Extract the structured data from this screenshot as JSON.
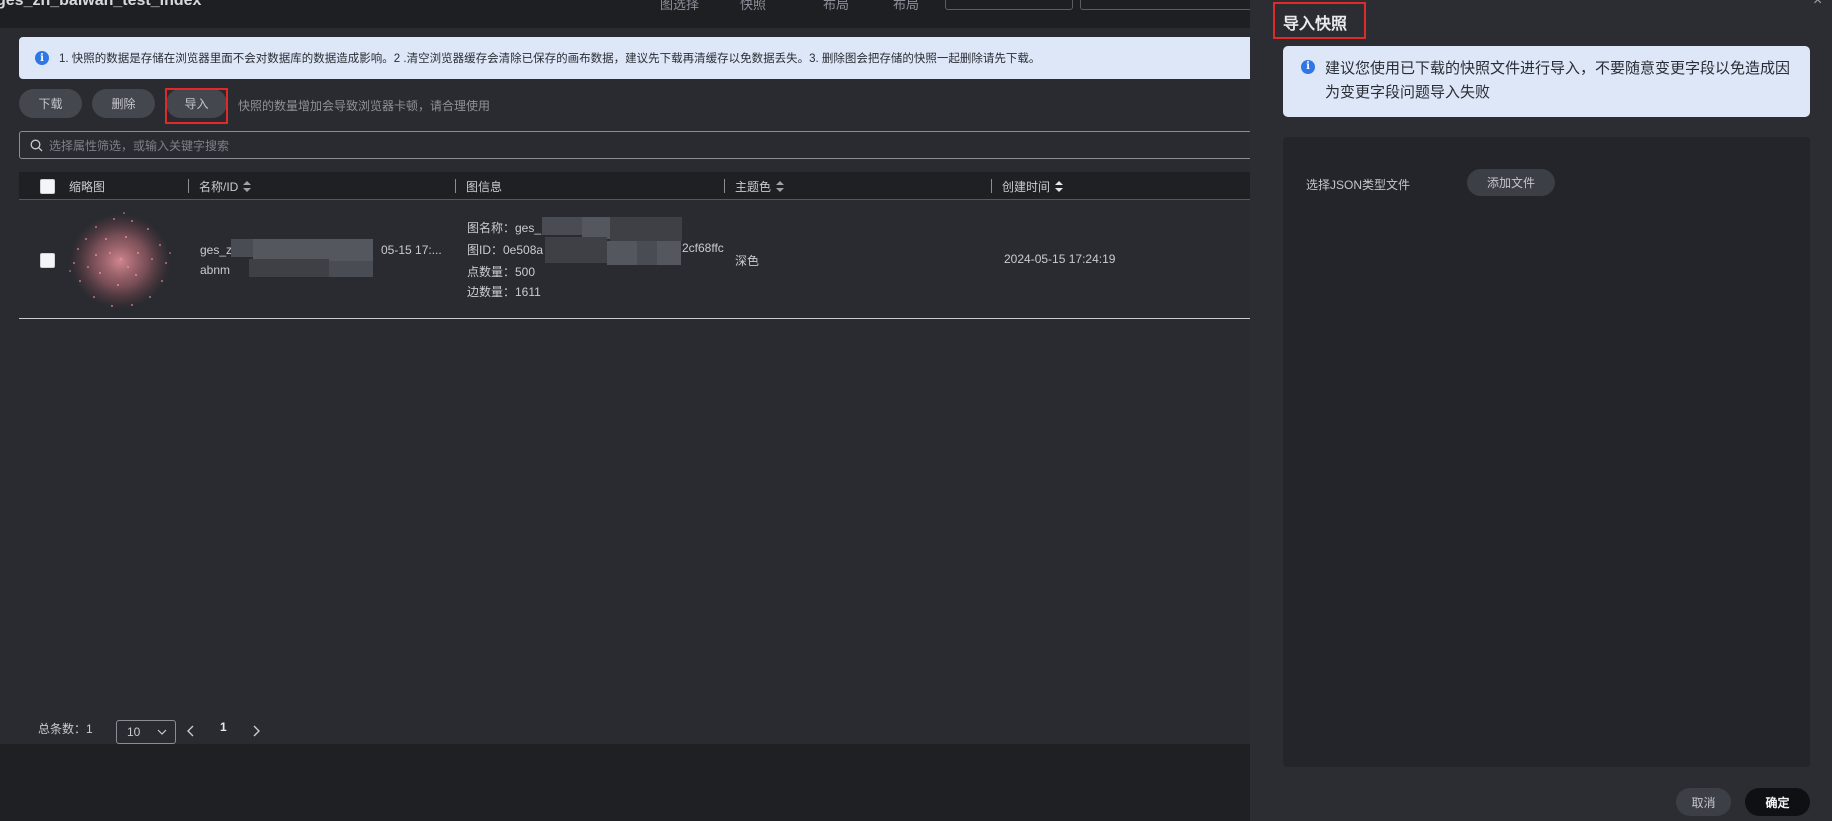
{
  "topbar": {
    "title": "ges_zh_baiwan_test_index",
    "links": [
      "图选择",
      "快照",
      "布局",
      "布局"
    ]
  },
  "notice": {
    "text": "1. 快照的数据是存储在浏览器里面不会对数据库的数据造成影响。2 .清空浏览器缓存会清除已保存的画布数据，建议先下载再清缓存以免数据丢失。3. 删除图会把存储的快照一起删除请先下载。"
  },
  "toolbar": {
    "download_label": "下载",
    "delete_label": "删除",
    "import_label": "导入",
    "hint": "快照的数量增加会导致浏览器卡顿，请合理使用"
  },
  "search": {
    "placeholder": "选择属性筛选，或输入关键字搜索"
  },
  "table": {
    "columns": [
      "缩略图",
      "名称/ID",
      "图信息",
      "主题色",
      "创建时间"
    ],
    "rows": [
      {
        "name_line1_start": "ges_z",
        "name_line1_end": "05-15 17:...",
        "name_line2_start": "abnm",
        "graph_name_label": "图名称：ges_",
        "graph_id_label": "图ID：0e508a",
        "graph_id_end": "2cf68ffc",
        "vertex_count": "点数量：500",
        "edge_count": "边数量：1611",
        "theme": "深色",
        "created": "2024-05-15 17:24:19"
      }
    ]
  },
  "pagination": {
    "total": "总条数：1",
    "page_size": "10",
    "current_page": "1"
  },
  "drawer": {
    "title": "导入快照",
    "tip": "建议您使用已下载的快照文件进行导入，不要随意变更字段以免造成因为变更字段问题导入失败",
    "file_label": "选择JSON类型文件",
    "add_file_label": "添加文件",
    "cancel_label": "取消",
    "confirm_label": "确定"
  },
  "colors": {
    "highlight": "#e02a2a",
    "info": "#2f77e6",
    "notice_bg": "#dde7f7"
  }
}
